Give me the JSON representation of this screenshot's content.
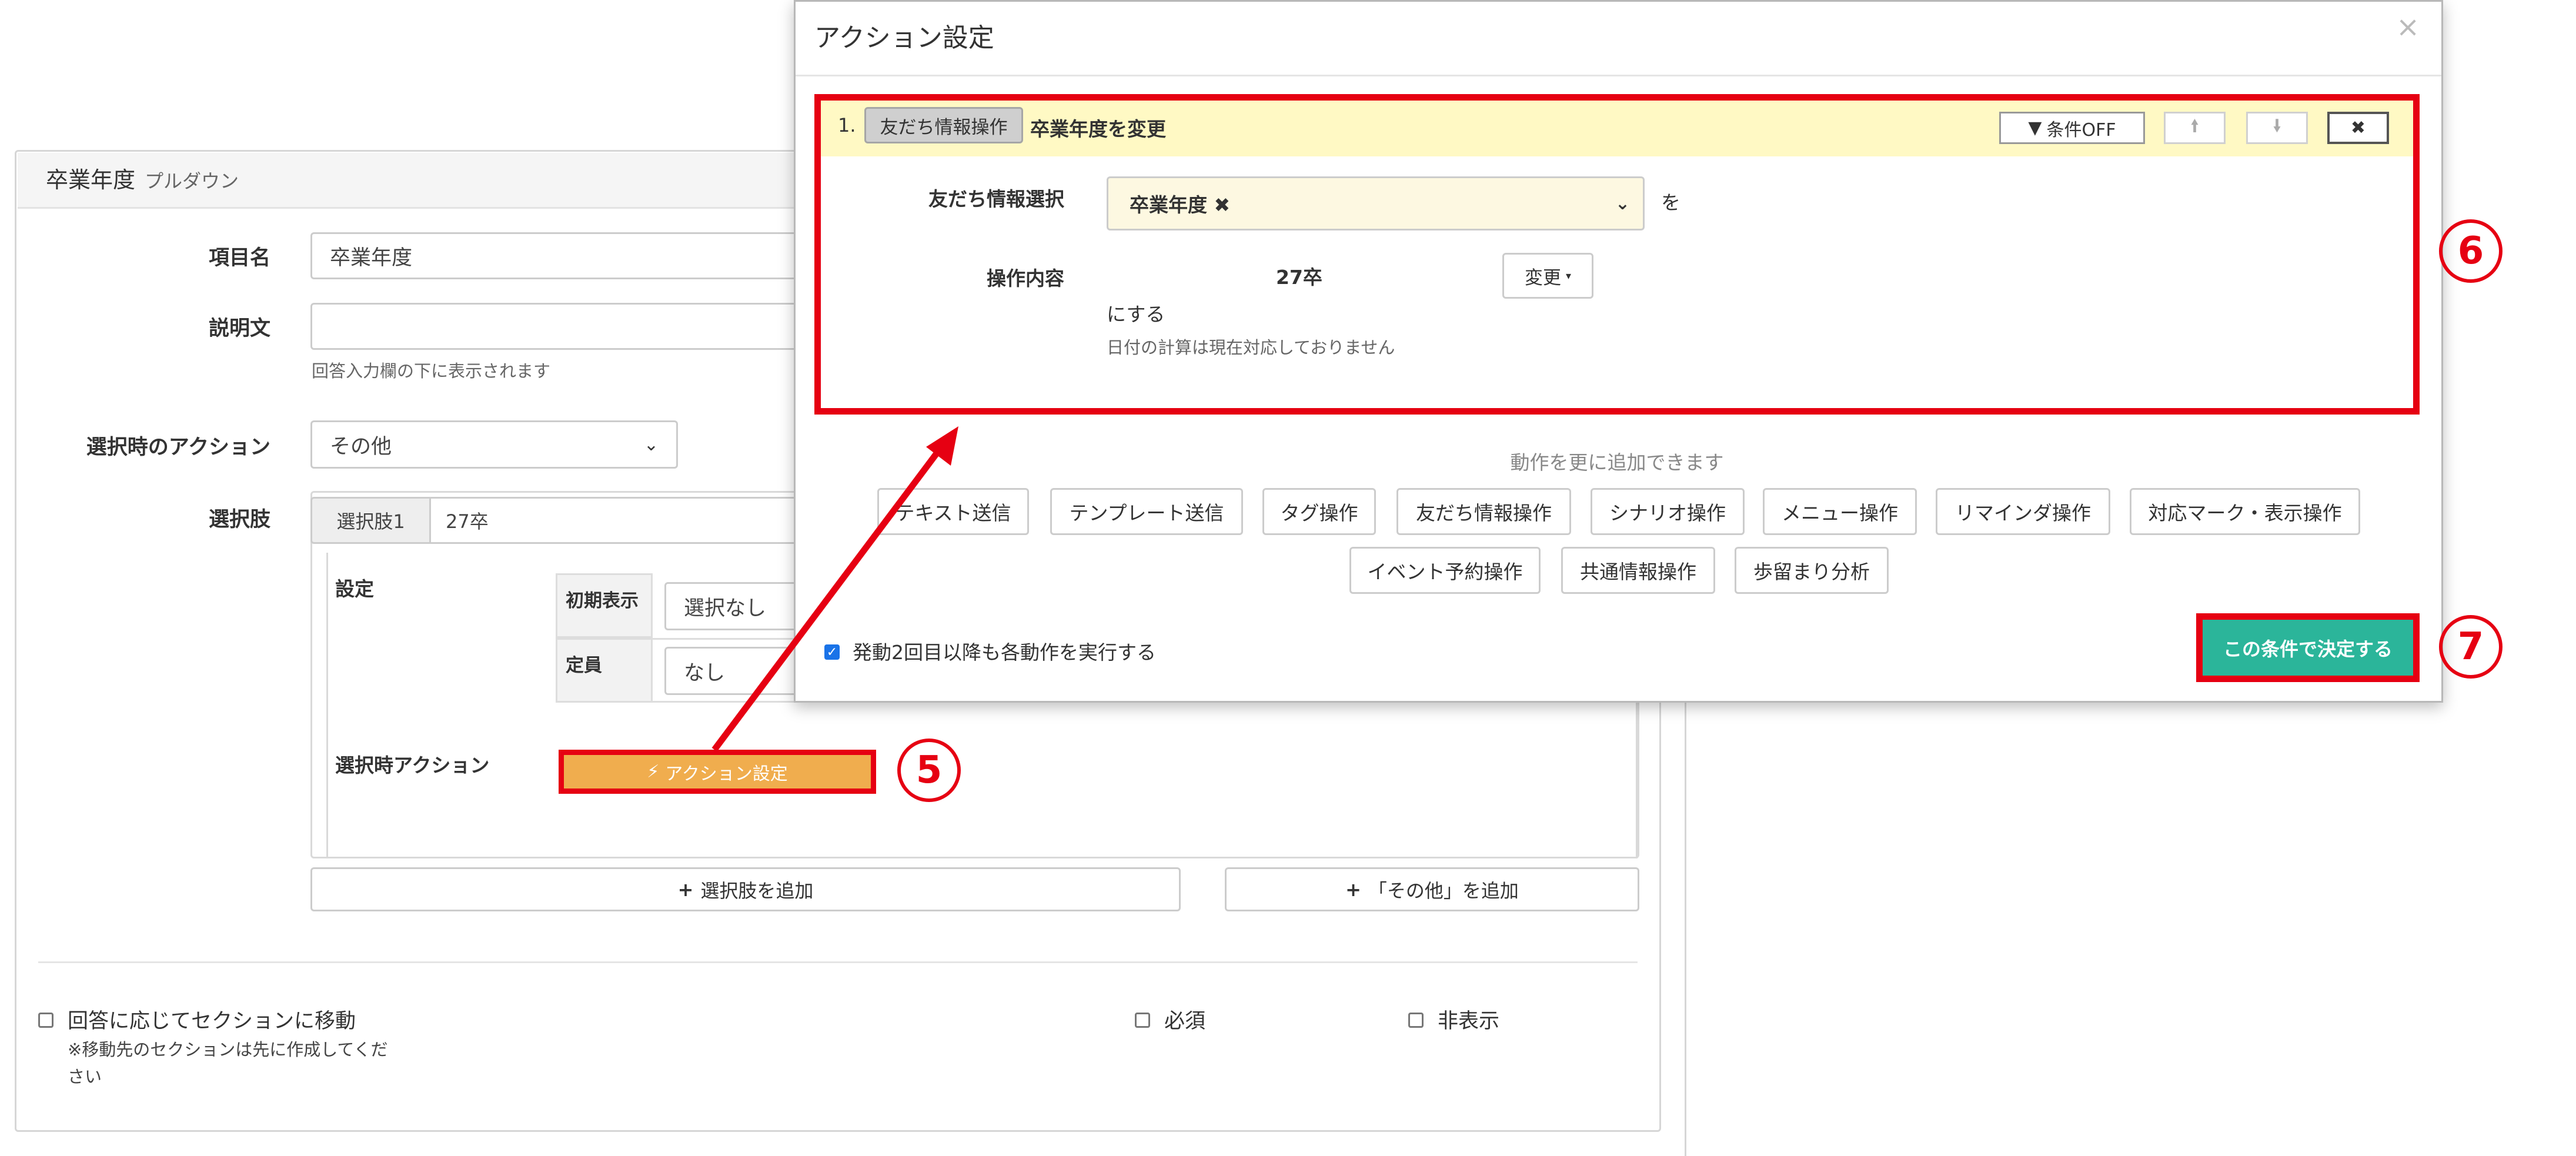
{
  "form": {
    "panel_title": "卒業年度",
    "panel_subtitle": "プルダウン",
    "item_name_label": "項目名",
    "item_name_value": "卒業年度",
    "description_label": "説明文",
    "description_value": "",
    "description_help": "回答入力欄の下に表示されます",
    "select_action_label": "選択時のアクション",
    "select_action_value": "その他",
    "choices_label": "選択肢",
    "choice_addon": "選択肢1",
    "choice_value": "27卒",
    "settings_label": "設定",
    "initial_display_label": "初期表示",
    "initial_display_value": "選択なし",
    "capacity_label": "定員",
    "capacity_value": "なし",
    "on_select_action_label": "選択時アクション",
    "action_settings_button": "アクション設定",
    "add_choice_button": "選択肢を追加",
    "add_other_button": "「その他」を追加",
    "move_section_checkbox": "回答に応じてセクションに移動",
    "move_section_note": "※移動先のセクションは先に作成してください",
    "required_checkbox": "必須",
    "hidden_checkbox": "非表示"
  },
  "modal": {
    "title": "アクション設定",
    "close": "×",
    "step": {
      "number": "1.",
      "badge": "友だち情報操作",
      "title": "卒業年度を変更",
      "condition_off_button": "条件OFF",
      "move_up_icon": "arrow-up-icon",
      "move_down_icon": "arrow-down-icon",
      "delete_icon": "close-icon",
      "friend_info_label": "友だち情報選択",
      "friend_info_value": "卒業年度",
      "friend_info_suffix": "を",
      "operation_label": "操作内容",
      "operation_value": "27卒",
      "change_button": "変更",
      "operation_suffix": "にする",
      "operation_help": "日付の計算は現在対応しておりません"
    },
    "add_more_help": "動作を更に追加できます",
    "action_buttons_row1": [
      "テキスト送信",
      "テンプレート送信",
      "タグ操作",
      "友だち情報操作",
      "シナリオ操作",
      "メニュー操作",
      "リマインダ操作",
      "対応マーク・表示操作"
    ],
    "action_buttons_row2": [
      "イベント予約操作",
      "共通情報操作",
      "歩留まり分析"
    ],
    "repeat_checkbox": "発動2回目以降も各動作を実行する",
    "confirm_button": "この条件で決定する"
  },
  "callouts": {
    "five": "5",
    "six": "6",
    "seven": "7"
  },
  "colors": {
    "highlight_red": "#e60012",
    "action_orange": "#f0ad4e",
    "confirm_green": "#2bb59a",
    "step_header_yellow": "#fff9c4"
  }
}
